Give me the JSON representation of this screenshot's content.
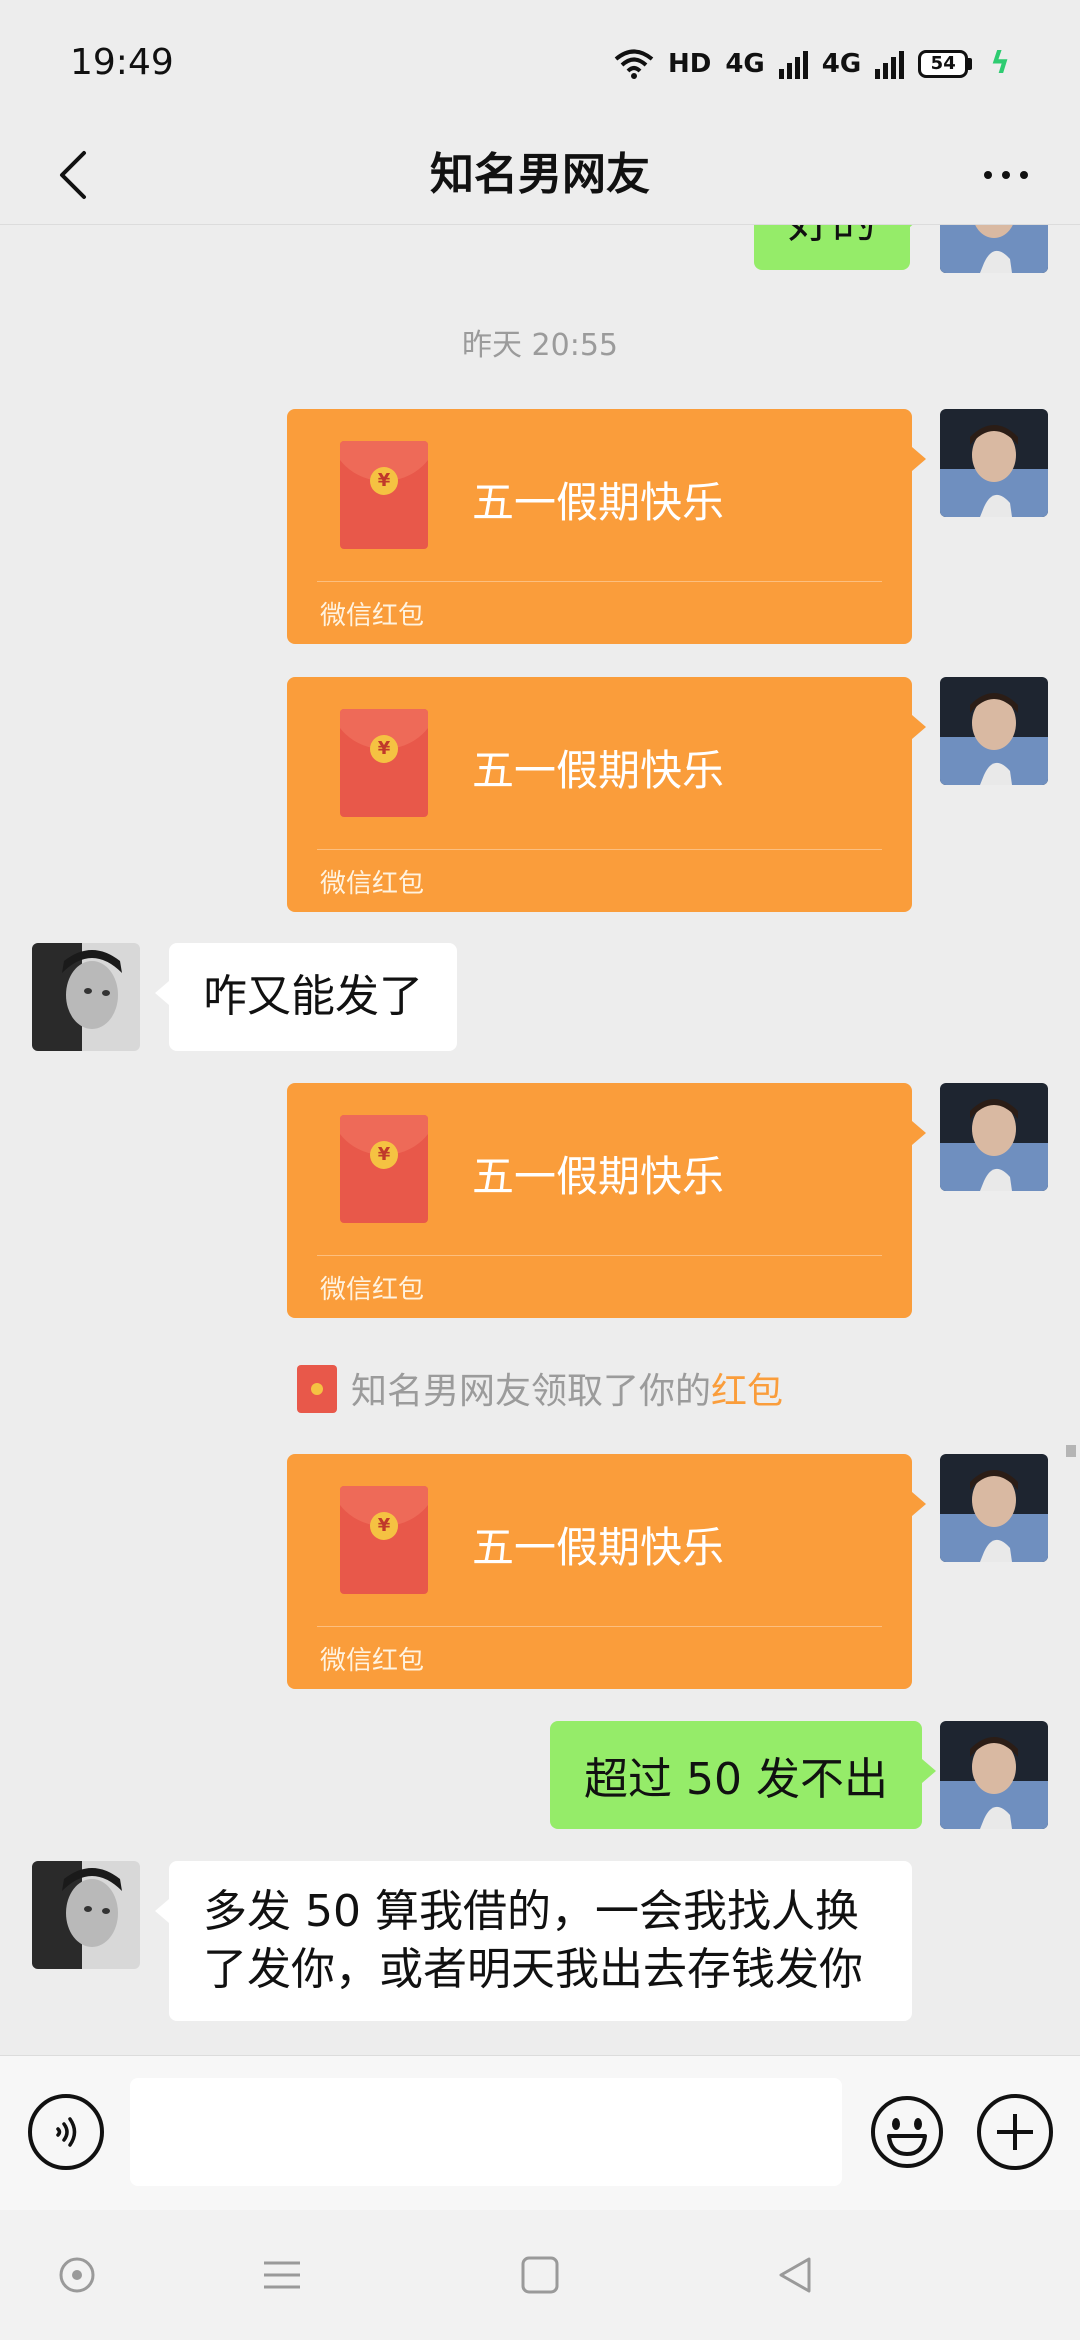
{
  "status_bar": {
    "time": "19:49",
    "network_hd": "HD",
    "sim1": "4G",
    "sim2": "4G",
    "battery": "54"
  },
  "header": {
    "title": "知名男网友"
  },
  "messages": {
    "m0": {
      "side": "right",
      "type": "text",
      "text": "好的"
    },
    "ts1": {
      "type": "timestamp",
      "text": "昨天 20:55"
    },
    "p1": {
      "side": "right",
      "type": "red_packet",
      "text": "五一假期快乐",
      "footer": "微信红包"
    },
    "p2": {
      "side": "right",
      "type": "red_packet",
      "text": "五一假期快乐",
      "footer": "微信红包"
    },
    "t1": {
      "side": "left",
      "type": "text",
      "text": "咋又能发了"
    },
    "p3": {
      "side": "right",
      "type": "red_packet",
      "text": "五一假期快乐",
      "footer": "微信红包"
    },
    "notice": {
      "type": "system",
      "text": "知名男网友领取了你的",
      "link": "红包"
    },
    "p4": {
      "side": "right",
      "type": "red_packet",
      "text": "五一假期快乐",
      "footer": "微信红包"
    },
    "t2": {
      "side": "right",
      "type": "text",
      "text": "超过 50 发不出"
    },
    "t3": {
      "side": "left",
      "type": "text",
      "line1": "多发 50 算我借的，一会我找人换",
      "line2": "了发你，或者明天我出去存钱发你"
    }
  },
  "input": {
    "placeholder": "",
    "value": ""
  },
  "icons": {
    "back": "chevron-left-icon",
    "more": "more-dots-icon",
    "voice": "voice-icon",
    "emoji": "emoji-icon",
    "plus": "plus-icon",
    "coin": "¥"
  },
  "colors": {
    "background": "#ededed",
    "self_bubble": "#95ec69",
    "other_bubble": "#ffffff",
    "red_packet": "#fa9d3b",
    "link": "#fa9d3b"
  }
}
